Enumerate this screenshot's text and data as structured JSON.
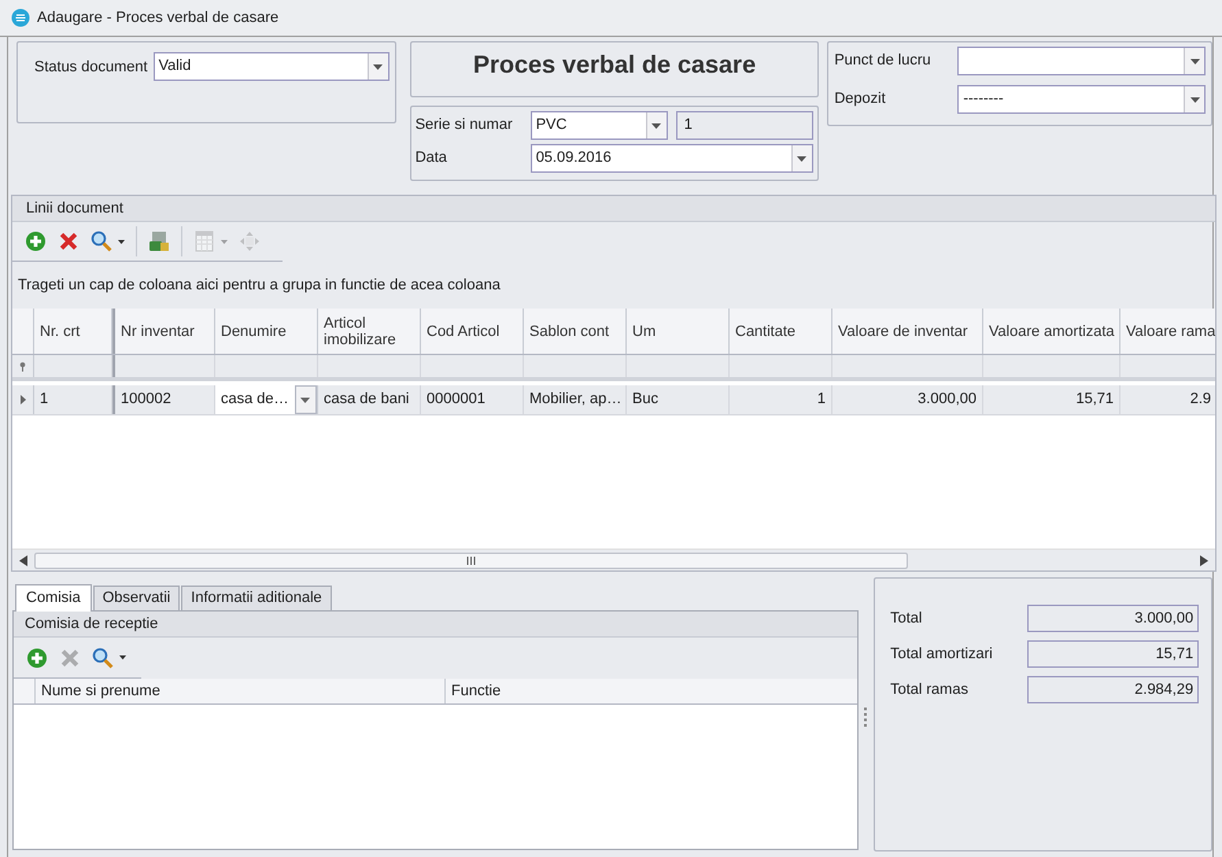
{
  "window": {
    "title": "Adaugare - Proces verbal de casare"
  },
  "header": {
    "status_label": "Status document",
    "status_value": "Valid",
    "doc_title": "Proces verbal de casare",
    "serie_label": "Serie si numar",
    "serie_value": "PVC",
    "number_value": "1",
    "date_label": "Data",
    "date_value": "05.09.2016",
    "punct_label": "Punct de lucru",
    "depozit_label": "Depozit",
    "depozit_value": "--------"
  },
  "lines": {
    "title": "Linii document",
    "toolbar": [
      {
        "kind": "add",
        "disabled": false
      },
      {
        "kind": "delete",
        "disabled": false
      },
      {
        "kind": "search",
        "disabled": false
      },
      {
        "kind": "export",
        "disabled": false
      },
      {
        "kind": "layout",
        "disabled": true
      },
      {
        "kind": "move",
        "disabled": true
      }
    ],
    "group_hint": "Trageti un cap de coloana aici pentru a grupa in functie de acea coloana",
    "columns": [
      {
        "label": "Nr. crt",
        "kind": "text"
      },
      {
        "label": "Nr inventar",
        "kind": "text"
      },
      {
        "label": "Denumire",
        "kind": "combo"
      },
      {
        "label": "Articol imobilizare",
        "kind": "text"
      },
      {
        "label": "Cod Articol",
        "kind": "text"
      },
      {
        "label": "Sablon cont",
        "kind": "text"
      },
      {
        "label": "Um",
        "kind": "text"
      },
      {
        "label": "Cantitate",
        "kind": "number"
      },
      {
        "label": "Valoare de inventar",
        "kind": "number"
      },
      {
        "label": "Valoare amortizata",
        "kind": "number"
      },
      {
        "label": "Valoare rama",
        "kind": "number"
      }
    ],
    "rows": [
      {
        "selected": true,
        "cells": [
          "1",
          "100002",
          "casa de…",
          "casa de bani",
          "0000001",
          "Mobilier, ap…",
          "Buc",
          "1",
          "3.000,00",
          "15,71",
          "2.9"
        ]
      }
    ]
  },
  "tabs": [
    {
      "label": "Comisia",
      "selected": true
    },
    {
      "label": "Observatii",
      "selected": false
    },
    {
      "label": "Informatii aditionale",
      "selected": false
    }
  ],
  "commission": {
    "title": "Comisia de receptie",
    "toolbar": [
      {
        "kind": "add",
        "disabled": false
      },
      {
        "kind": "delete",
        "disabled": true
      },
      {
        "kind": "search",
        "disabled": false
      }
    ],
    "columns": [
      "Nume si prenume",
      "Functie"
    ]
  },
  "totals": [
    {
      "label": "Total",
      "value": "3.000,00"
    },
    {
      "label": "Total amortizari",
      "value": "15,71"
    },
    {
      "label": "Total ramas",
      "value": "2.984,29"
    }
  ]
}
